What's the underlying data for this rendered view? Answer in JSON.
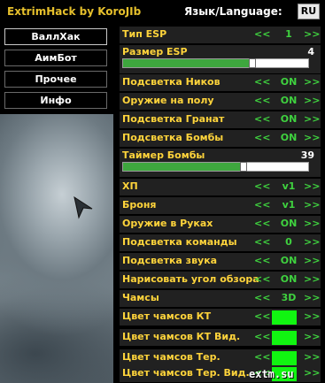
{
  "title": "ExtrimHack by KoroJIb",
  "language": {
    "label": "Язык/Language:",
    "button": "RU"
  },
  "tabs": [
    "ВаллХак",
    "АимБот",
    "Прочее",
    "Инфо"
  ],
  "arrows": {
    "prev": "<<",
    "next": ">>"
  },
  "esp_type": {
    "label": "Тип ESP",
    "value": "1"
  },
  "esp_size": {
    "label": "Размер ESP",
    "value": "4",
    "fraction": 0.7
  },
  "toggles": [
    {
      "label": "Подсветка Ников",
      "value": "ON"
    },
    {
      "label": "Оружие на полу",
      "value": "ON"
    },
    {
      "label": "Подсветка Гранат",
      "value": "ON"
    },
    {
      "label": "Подсветка Бомбы",
      "value": "ON"
    }
  ],
  "bomb_timer": {
    "label": "Таймер Бомбы",
    "value": "39",
    "fraction": 0.65
  },
  "rows2": [
    {
      "label": "ХП",
      "value": "v1"
    },
    {
      "label": "Броня",
      "value": "v1"
    },
    {
      "label": "Оружие в Руках",
      "value": "ON"
    },
    {
      "label": "Подсветка команды",
      "value": "0"
    },
    {
      "label": "Подсветка звука",
      "value": "ON"
    },
    {
      "label": "Нарисовать угол обзора",
      "value": "ON"
    },
    {
      "label": "Чамсы",
      "value": "3D"
    }
  ],
  "colors": [
    {
      "label": "Цвет чамсов КТ",
      "color": "#11f511"
    },
    {
      "label": "Цвет чамсов КТ Вид.",
      "color": "#11f511"
    },
    {
      "label": "Цвет чамсов Тер.",
      "color": "#11f511"
    },
    {
      "label": "Цвет чамсов Тер. Вид.",
      "color": "#11f511"
    }
  ],
  "watermark": "extm.su"
}
